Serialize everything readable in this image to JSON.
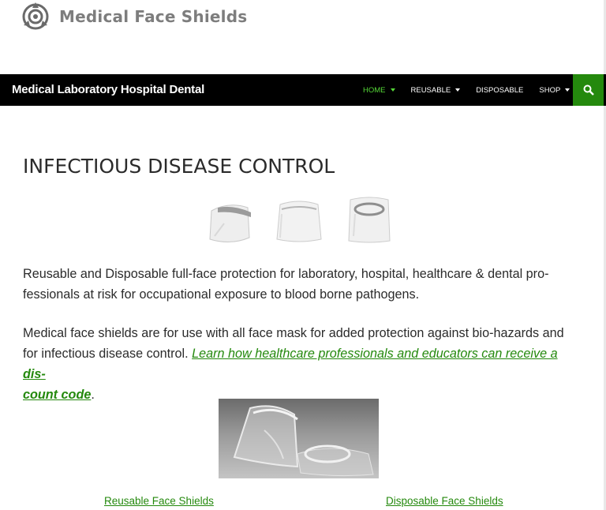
{
  "brand": {
    "logo_text": "Medical Face Shields",
    "logo_icon": "shield-logo-icon"
  },
  "navbar": {
    "site_title": "Medical Laboratory Hospital Dental",
    "menu": [
      {
        "label": "HOME",
        "dropdown": true,
        "active": true
      },
      {
        "label": "REUSABLE",
        "dropdown": true,
        "active": false
      },
      {
        "label": "DISPOSABLE",
        "dropdown": false,
        "active": false
      },
      {
        "label": "SHOP",
        "dropdown": true,
        "active": false
      }
    ],
    "search_icon": "search-icon"
  },
  "main": {
    "title": "INFECTIOUS DISEASE CONTROL",
    "para1_line1": "Reusable and Disposable full-face protection for laboratory, hospital, healthcare & dental pro-",
    "para1_line2": "fessionals at risk for occupational exposure to blood borne pathogens.",
    "para2_line1": "Medical face shields are for use with all face mask for added protection against bio-hazards and",
    "para2_line2_prefix": "for infectious disease control. ",
    "para2_link_part1": "Learn how healthcare professionals and educators can receive a ",
    "para2_link_bold1": "dis-",
    "para2_link_bold2": "count code",
    "para2_suffix": "."
  },
  "links": {
    "reusable": "Reusable Face Shields",
    "disposable": "Disposable Face Shields"
  },
  "colors": {
    "accent": "#24890d",
    "active_menu": "#55d737",
    "navbar_bg": "#000000"
  }
}
